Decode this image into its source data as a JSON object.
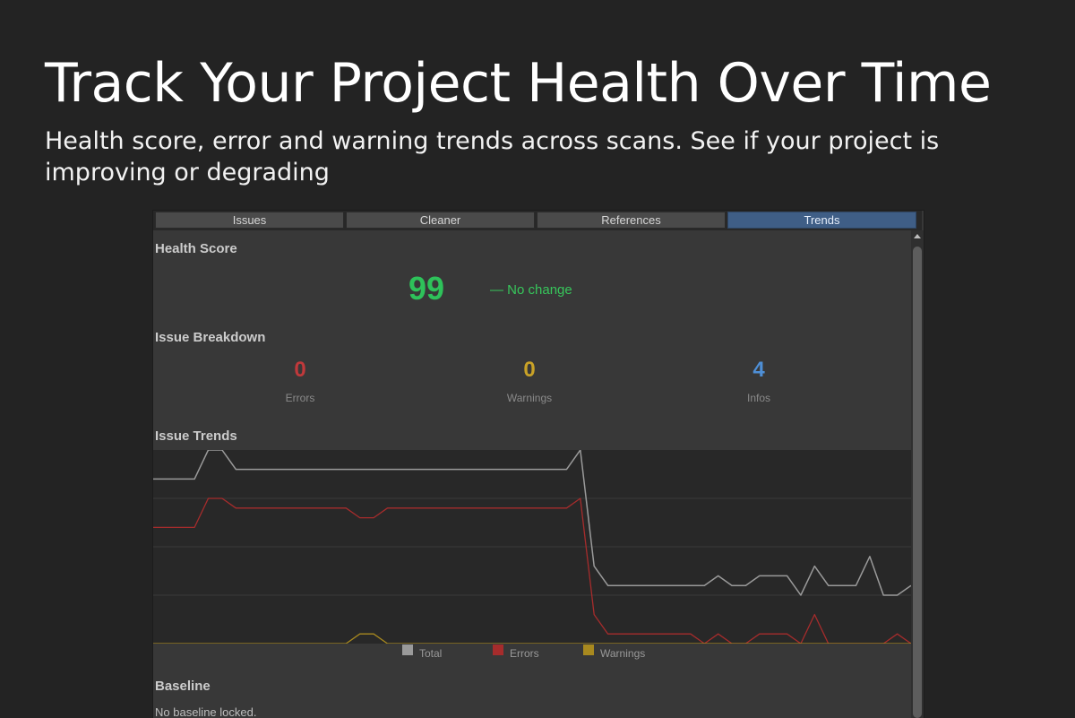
{
  "hero": {
    "title": "Track Your Project Health Over Time",
    "subtitle": "Health score, error and warning trends across scans. See if your project is improving or degrading"
  },
  "tabs": [
    {
      "label": "Issues",
      "active": false
    },
    {
      "label": "Cleaner",
      "active": false
    },
    {
      "label": "References",
      "active": false
    },
    {
      "label": "Trends",
      "active": true
    }
  ],
  "health": {
    "section_label": "Health Score",
    "score": "99",
    "change": "— No change",
    "score_color": "#2ec25a"
  },
  "breakdown": {
    "section_label": "Issue Breakdown",
    "errors": {
      "value": "0",
      "label": "Errors",
      "color": "#c0393b"
    },
    "warnings": {
      "value": "0",
      "label": "Warnings",
      "color": "#c9a227"
    },
    "infos": {
      "value": "4",
      "label": "Infos",
      "color": "#4e8fd6"
    }
  },
  "trends": {
    "section_label": "Issue Trends",
    "legend": [
      {
        "name": "Total",
        "color": "#9a9a9a"
      },
      {
        "name": "Errors",
        "color": "#a62c2c"
      },
      {
        "name": "Warnings",
        "color": "#a8891f"
      }
    ]
  },
  "baseline": {
    "section_label": "Baseline",
    "text": "No baseline locked."
  },
  "chart_data": {
    "type": "line",
    "title": "",
    "xlabel": "",
    "ylabel": "",
    "grid": true,
    "legend": "bottom",
    "ylim": [
      0,
      20
    ],
    "x": [
      0,
      1,
      2,
      3,
      4,
      5,
      6,
      7,
      8,
      9,
      10,
      11,
      12,
      13,
      14,
      15,
      16,
      17,
      18,
      19,
      20,
      21,
      22,
      23,
      24,
      25,
      26,
      27,
      28,
      29,
      30,
      31,
      32,
      33,
      34,
      35,
      36,
      37,
      38,
      39,
      40,
      41,
      42,
      43,
      44,
      45,
      46,
      47,
      48,
      49,
      50,
      51,
      52,
      53,
      54,
      55
    ],
    "series": [
      {
        "name": "Total",
        "color": "#9a9a9a",
        "values": [
          17,
          17,
          17,
          17,
          20,
          20,
          18,
          18,
          18,
          18,
          18,
          18,
          18,
          18,
          18,
          18,
          18,
          18,
          18,
          18,
          18,
          18,
          18,
          18,
          18,
          18,
          18,
          18,
          18,
          18,
          18,
          20,
          8,
          6,
          6,
          6,
          6,
          6,
          6,
          6,
          6,
          7,
          6,
          6,
          7,
          7,
          7,
          5,
          8,
          6,
          6,
          6,
          9,
          5,
          5,
          6
        ]
      },
      {
        "name": "Errors",
        "color": "#a62c2c",
        "values": [
          12,
          12,
          12,
          12,
          15,
          15,
          14,
          14,
          14,
          14,
          14,
          14,
          14,
          14,
          14,
          13,
          13,
          14,
          14,
          14,
          14,
          14,
          14,
          14,
          14,
          14,
          14,
          14,
          14,
          14,
          14,
          15,
          3,
          1,
          1,
          1,
          1,
          1,
          1,
          1,
          0,
          1,
          0,
          0,
          1,
          1,
          1,
          0,
          3,
          0,
          0,
          0,
          0,
          0,
          1,
          0
        ]
      },
      {
        "name": "Warnings",
        "color": "#a8891f",
        "values": [
          0,
          0,
          0,
          0,
          0,
          0,
          0,
          0,
          0,
          0,
          0,
          0,
          0,
          0,
          0,
          1,
          1,
          0,
          0,
          0,
          0,
          0,
          0,
          0,
          0,
          0,
          0,
          0,
          0,
          0,
          0,
          0,
          0,
          0,
          0,
          0,
          0,
          0,
          0,
          0,
          0,
          0,
          0,
          0,
          0,
          0,
          0,
          0,
          0,
          0,
          0,
          0,
          0,
          0,
          0,
          0
        ]
      }
    ]
  }
}
